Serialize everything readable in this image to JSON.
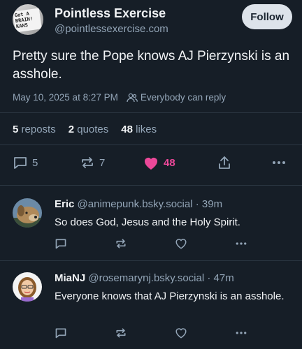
{
  "post": {
    "author_name": "Pointless Exercise",
    "author_handle": "@pointlessexercise.com",
    "follow_label": "Follow",
    "avatar_sign_text": "Got A BRAIN! KANS",
    "text": "Pretty sure the Pope knows AJ Pierzynski is an asshole.",
    "timestamp": "May 10, 2025 at 8:27 PM",
    "reply_setting": "Everybody can reply",
    "stats": {
      "reposts_count": "5",
      "reposts_label": "reposts",
      "quotes_count": "2",
      "quotes_label": "quotes",
      "likes_count": "48",
      "likes_label": "likes"
    },
    "actions": {
      "replies": "5",
      "reposts": "7",
      "likes": "48"
    },
    "colors": {
      "like": "#ec4899",
      "muted": "#93a5b7",
      "background": "#161e27"
    }
  },
  "replies": [
    {
      "name": "Eric",
      "handle": "@animepunk.bsky.social",
      "time": "· 39m",
      "text": "So does God, Jesus and the Holy Spirit."
    },
    {
      "name": "MiaNJ",
      "handle": "@rosemarynj.bsky.social",
      "time": "· 47m",
      "text": "Everyone knows that AJ Pierzynski is an asshole."
    }
  ]
}
